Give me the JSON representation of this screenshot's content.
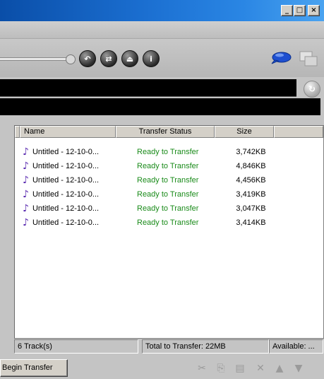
{
  "titlebar": {
    "buttons": [
      {
        "name": "minimize",
        "glyph": "_"
      },
      {
        "name": "maximize",
        "glyph": "□"
      },
      {
        "name": "close",
        "glyph": "×"
      }
    ]
  },
  "controls": {
    "buttons": [
      {
        "name": "back",
        "glyph": "↶"
      },
      {
        "name": "sync",
        "glyph": "⇄"
      },
      {
        "name": "eject",
        "glyph": "⏏"
      },
      {
        "name": "info",
        "glyph": "i"
      }
    ]
  },
  "transfer_list": {
    "columns": [
      "Name",
      "Transfer Status",
      "Size"
    ],
    "rows": [
      {
        "name": "Untitled - 12-10-0...",
        "status": "Ready to Transfer",
        "size": "3,742KB"
      },
      {
        "name": "Untitled - 12-10-0...",
        "status": "Ready to Transfer",
        "size": "4,846KB"
      },
      {
        "name": "Untitled - 12-10-0...",
        "status": "Ready to Transfer",
        "size": "4,456KB"
      },
      {
        "name": "Untitled - 12-10-0...",
        "status": "Ready to Transfer",
        "size": "3,419KB"
      },
      {
        "name": "Untitled - 12-10-0...",
        "status": "Ready to Transfer",
        "size": "3,047KB"
      },
      {
        "name": "Untitled - 12-10-0...",
        "status": "Ready to Transfer",
        "size": "3,414KB"
      }
    ]
  },
  "statusbar": {
    "tracks": "6 Track(s)",
    "total": "Total to Transfer: 22MB",
    "available": "Available: ..."
  },
  "bottombar": {
    "begin_label": "Begin Transfer"
  },
  "colors": {
    "status_text": "#1a8b1a",
    "title_gradient_start": "#0a4ea8",
    "title_gradient_end": "#4aa3f0"
  }
}
